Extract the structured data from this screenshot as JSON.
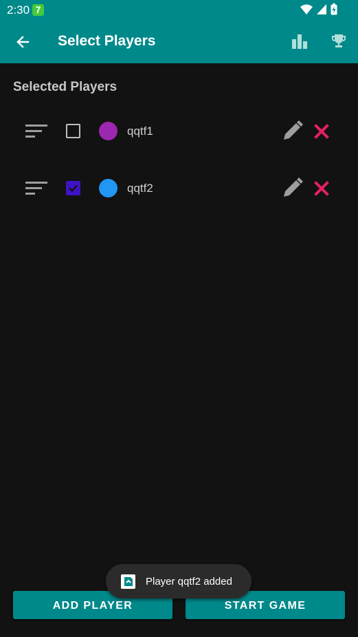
{
  "status_bar": {
    "time": "2:30",
    "notification_badge": "7"
  },
  "app_bar": {
    "title": "Select Players",
    "back_icon": "arrow-left-icon",
    "stats_icon": "bar-chart-icon",
    "trophy_icon": "trophy-icon",
    "background": "#00898a"
  },
  "section": {
    "title": "Selected Players"
  },
  "players": [
    {
      "name": "qqtf1",
      "checked": false,
      "color": "#9c27b0"
    },
    {
      "name": "qqtf2",
      "checked": true,
      "color": "#2196f3"
    }
  ],
  "colors": {
    "delete": "#e91e63",
    "checkbox_checked": "#3f13c4"
  },
  "buttons": {
    "add_player": "ADD PLAYER",
    "start_game": "START GAME"
  },
  "toast": {
    "message": "Player qqtf2 added"
  }
}
